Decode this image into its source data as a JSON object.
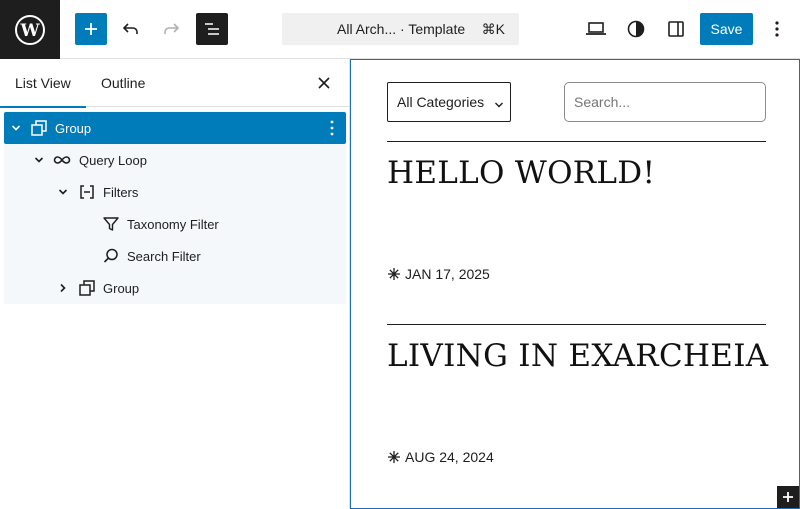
{
  "header": {
    "save_label": "Save",
    "command_title": "All Arch... · Template",
    "command_shortcut": "⌘K"
  },
  "sidebar": {
    "tabs": [
      {
        "label": "List View",
        "active": true
      },
      {
        "label": "Outline",
        "active": false
      }
    ],
    "tree": [
      {
        "label": "Group",
        "icon": "group-icon",
        "expanded": true,
        "selected": true
      },
      {
        "label": "Query Loop",
        "icon": "loop-icon",
        "expanded": true,
        "selected": false
      },
      {
        "label": "Filters",
        "icon": "filters-icon",
        "expanded": true,
        "selected": false
      },
      {
        "label": "Taxonomy Filter",
        "icon": "funnel-icon",
        "selected": false
      },
      {
        "label": "Search Filter",
        "icon": "search-icon",
        "selected": false
      },
      {
        "label": "Group",
        "icon": "group-icon",
        "expanded": false,
        "selected": false
      }
    ]
  },
  "canvas": {
    "category_select": "All Categories",
    "search_placeholder": "Search...",
    "posts": [
      {
        "title": "HELLO WORLD!",
        "date": "JAN 17, 2025"
      },
      {
        "title": "LIVING IN EXARCHEIA",
        "date": "AUG 24, 2024"
      }
    ]
  },
  "colors": {
    "accent": "#007cba",
    "dark": "#1e1e1e",
    "tree_bg": "#f4f8fb"
  }
}
